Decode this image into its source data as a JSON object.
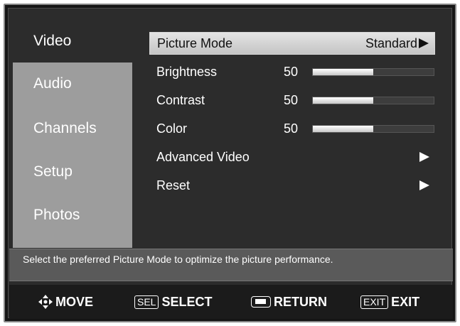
{
  "sidebar": {
    "items": [
      {
        "label": "Video",
        "active": true
      },
      {
        "label": "Audio",
        "active": false
      },
      {
        "label": "Channels",
        "active": false
      },
      {
        "label": "Setup",
        "active": false
      },
      {
        "label": "Photos",
        "active": false
      }
    ]
  },
  "menu": {
    "picture_mode": {
      "label": "Picture Mode",
      "value": "Standard"
    },
    "brightness": {
      "label": "Brightness",
      "value": "50",
      "level": 0.5
    },
    "contrast": {
      "label": "Contrast",
      "value": "50",
      "level": 0.5
    },
    "color": {
      "label": "Color",
      "value": "50",
      "level": 0.5
    },
    "advanced_video": {
      "label": "Advanced Video"
    },
    "reset": {
      "label": "Reset"
    }
  },
  "help_text": "Select the preferred Picture Mode to optimize the picture performance.",
  "footer": {
    "move": "MOVE",
    "sel_key": "SEL",
    "select": "SELECT",
    "return": "RETURN",
    "exit_key": "EXIT",
    "exit": "EXIT"
  },
  "colors": {
    "background": "#2c2c2c",
    "sidebar": "#9d9d9d",
    "highlight": "#d4d4d4",
    "help_bar": "#5a5a5a"
  }
}
